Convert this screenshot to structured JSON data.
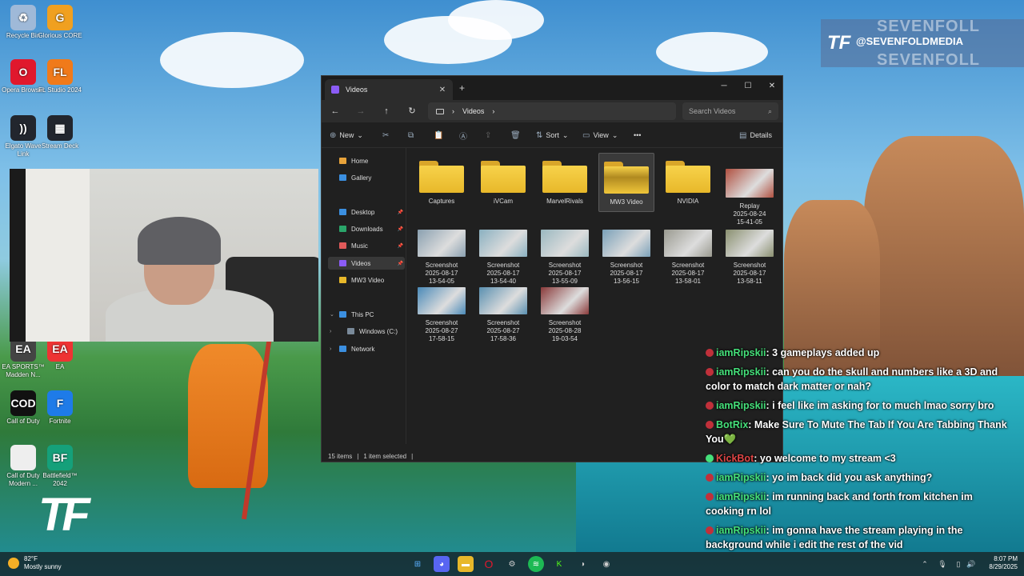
{
  "desktop": {
    "icons": [
      {
        "label": "Recycle Bin",
        "color": "#9fb9d8",
        "glyph": "♻"
      },
      {
        "label": "Glorious CORE",
        "color": "#f0a020",
        "glyph": "G"
      },
      {
        "label": "Opera Browser",
        "color": "#e0182d",
        "glyph": "O"
      },
      {
        "label": "FL Studio 2024",
        "color": "#f07a1a",
        "glyph": "FL"
      },
      {
        "label": "Elgato Wave Link",
        "color": "#22262e",
        "glyph": "))"
      },
      {
        "label": "Stream Deck",
        "color": "#22262e",
        "glyph": "▦"
      },
      {
        "label": "EA SPORTS™ Madden N...",
        "color": "#444",
        "glyph": "EA"
      },
      {
        "label": "EA",
        "color": "#e33",
        "glyph": "EA"
      },
      {
        "label": "Call of Duty",
        "color": "#111",
        "glyph": "COD"
      },
      {
        "label": "Fortnite",
        "color": "#1e7be8",
        "glyph": "F"
      },
      {
        "label": "Call of Duty Modern ...",
        "color": "#eee",
        "glyph": ""
      },
      {
        "label": "Battlefield™ 2042",
        "color": "#15a07a",
        "glyph": "BF"
      }
    ]
  },
  "overlay": {
    "brand_handle": "@SEVENFOLDMEDIA",
    "brand_big": "SEVENFOLL",
    "brand_logo": "TF",
    "big_logo": "TF"
  },
  "explorer": {
    "tab_title": "Videos",
    "breadcrumb": "Videos",
    "search_placeholder": "Search Videos",
    "commands": {
      "new": "New",
      "sort": "Sort",
      "view": "View",
      "details": "Details"
    },
    "nav": [
      {
        "label": "Home",
        "color": "#e8a33a"
      },
      {
        "label": "Gallery",
        "color": "#3b8fe0"
      },
      {
        "label": "Desktop",
        "color": "#3b8fe0"
      },
      {
        "label": "Downloads",
        "color": "#2aa56a"
      },
      {
        "label": "Music",
        "color": "#e05a5a"
      },
      {
        "label": "Videos",
        "color": "#8b5cf6"
      },
      {
        "label": "MW3 Video",
        "color": "#e8b82a"
      },
      {
        "label": "This PC",
        "color": "#3b8fe0"
      },
      {
        "label": "Windows (C:)",
        "color": "#7a8a9a"
      },
      {
        "label": "Network",
        "color": "#3b8fe0"
      }
    ],
    "items": [
      {
        "label": "Captures",
        "type": "folder"
      },
      {
        "label": "iVCam",
        "type": "folder"
      },
      {
        "label": "MarvelRivals",
        "type": "folder"
      },
      {
        "label": "MW3 Video",
        "type": "folder",
        "selected": true
      },
      {
        "label": "NVIDIA",
        "type": "folder"
      },
      {
        "label": "Replay\n2025-08-24\n15-41-05",
        "type": "video",
        "color": "#b05040"
      },
      {
        "label": "Screenshot\n2025-08-17\n13-54-05",
        "type": "image",
        "color": "#8aa0b0"
      },
      {
        "label": "Screenshot\n2025-08-17\n13-54-40",
        "type": "image",
        "color": "#8ab0c0"
      },
      {
        "label": "Screenshot\n2025-08-17\n13-55-09",
        "type": "image",
        "color": "#9ab8c0"
      },
      {
        "label": "Screenshot\n2025-08-17\n13-56-15",
        "type": "image",
        "color": "#7aa0b8"
      },
      {
        "label": "Screenshot\n2025-08-17\n13-58-01",
        "type": "image",
        "color": "#9a9a90"
      },
      {
        "label": "Screenshot\n2025-08-17\n13-58-11",
        "type": "image",
        "color": "#8a9070"
      },
      {
        "label": "Screenshot\n2025-08-27\n17-58-15",
        "type": "image",
        "color": "#4a8ab8"
      },
      {
        "label": "Screenshot\n2025-08-27\n17-58-36",
        "type": "image",
        "color": "#5a90b0"
      },
      {
        "label": "Screenshot\n2025-08-28\n19-03-54",
        "type": "image",
        "color": "#8a3a3a"
      }
    ],
    "status_count": "15 items",
    "status_selected": "1 item selected"
  },
  "chat": [
    {
      "user": "iamRipskii",
      "text": "3 gameplays added up",
      "ucolor": "green"
    },
    {
      "user": "iamRipskii",
      "text": "can you do the skull and numbers like a 3D and color to match dark matter or nah?",
      "ucolor": "green"
    },
    {
      "user": "iamRipskii",
      "text": "i feel like im asking for to much lmao sorry bro",
      "ucolor": "green"
    },
    {
      "user": "BotRix",
      "text": "Make Sure To Mute The Tab If You Are Tabbing Thank You💚",
      "ucolor": "green"
    },
    {
      "user": "KickBot",
      "text": "yo welcome to my stream <3",
      "ucolor": "red"
    },
    {
      "user": "iamRipskii",
      "text": "yo im back did you ask anything?",
      "ucolor": "green"
    },
    {
      "user": "iamRipskii",
      "text": "im running back and forth from kitchen im cooking rn lol",
      "ucolor": "green"
    },
    {
      "user": "iamRipskii",
      "text": "im gonna have the stream playing in the background while i edit the rest of the vid",
      "ucolor": "green"
    }
  ],
  "taskbar": {
    "temp": "82°F",
    "weather": "Mostly sunny",
    "time": "8:07 PM",
    "date": "8/29/2025"
  }
}
